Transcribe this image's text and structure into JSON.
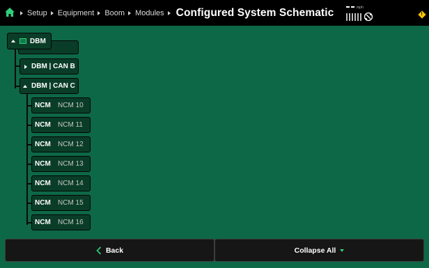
{
  "header": {
    "breadcrumbs": [
      "Setup",
      "Equipment",
      "Boom",
      "Modules"
    ],
    "title": "Configured System Schematic",
    "speed_unit": "mph",
    "warning_badge": "!"
  },
  "tree": {
    "root": {
      "label": "DBM"
    },
    "can_b": {
      "label": "DBM | CAN B"
    },
    "can_c": {
      "label": "DBM | CAN C"
    },
    "ncm_items": [
      {
        "type": "NCM",
        "name": "NCM 10"
      },
      {
        "type": "NCM",
        "name": "NCM 11"
      },
      {
        "type": "NCM",
        "name": "NCM 12"
      },
      {
        "type": "NCM",
        "name": "NCM 13"
      },
      {
        "type": "NCM",
        "name": "NCM 14"
      },
      {
        "type": "NCM",
        "name": "NCM 15"
      },
      {
        "type": "NCM",
        "name": "NCM 16"
      }
    ]
  },
  "footer": {
    "back_label": "Back",
    "collapse_label": "Collapse All"
  },
  "colors": {
    "background": "#0d6847",
    "accent": "#2fd07a",
    "warning": "#f4c400"
  },
  "icons": [
    "home-icon",
    "gps-satellite-icon",
    "warning-icon",
    "chevron-left-icon",
    "dropdown-arrow-icon",
    "module-icon"
  ]
}
